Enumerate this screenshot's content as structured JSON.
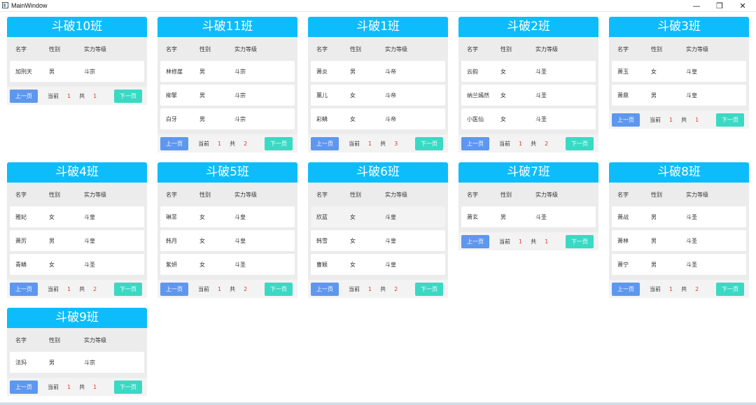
{
  "window": {
    "title": "MainWindow",
    "minimize_glyph": "—",
    "restore_glyph": "❐",
    "close_glyph": "✕"
  },
  "labels": {
    "col_name": "名字",
    "col_gender": "性别",
    "col_level": "实力等级",
    "prev": "上一页",
    "next": "下一页",
    "current": "当前",
    "total": "共"
  },
  "panels": [
    {
      "title": "斗破10班",
      "current": "1",
      "total": "1",
      "rows": [
        [
          "加刑天",
          "男",
          "斗宗"
        ]
      ]
    },
    {
      "title": "斗破11班",
      "current": "1",
      "total": "2",
      "rows": [
        [
          "林修崖",
          "男",
          "斗宗"
        ],
        [
          "柳擎",
          "男",
          "斗宗"
        ],
        [
          "白牙",
          "男",
          "斗宗"
        ]
      ]
    },
    {
      "title": "斗破1班",
      "current": "1",
      "total": "3",
      "rows": [
        [
          "萧炎",
          "男",
          "斗帝"
        ],
        [
          "薰儿",
          "女",
          "斗帝"
        ],
        [
          "彩鳞",
          "女",
          "斗帝"
        ]
      ]
    },
    {
      "title": "斗破2班",
      "current": "1",
      "total": "2",
      "rows": [
        [
          "云韵",
          "女",
          "斗圣"
        ],
        [
          "纳兰嫣然",
          "女",
          "斗圣"
        ],
        [
          "小医仙",
          "女",
          "斗圣"
        ]
      ]
    },
    {
      "title": "斗破3班",
      "current": "1",
      "total": "1",
      "rows": [
        [
          "萧玉",
          "女",
          "斗皇"
        ],
        [
          "萧鼎",
          "男",
          "斗皇"
        ]
      ]
    },
    {
      "title": "斗破4班",
      "current": "1",
      "total": "2",
      "rows": [
        [
          "雅妃",
          "女",
          "斗皇"
        ],
        [
          "萧厉",
          "男",
          "斗皇"
        ],
        [
          "青鳞",
          "女",
          "斗圣"
        ]
      ]
    },
    {
      "title": "斗破5班",
      "current": "1",
      "total": "2",
      "rows": [
        [
          "琳菲",
          "女",
          "斗皇"
        ],
        [
          "韩月",
          "女",
          "斗皇"
        ],
        [
          "紫妍",
          "女",
          "斗圣"
        ]
      ]
    },
    {
      "title": "斗破6班",
      "current": "1",
      "total": "2",
      "rows": [
        [
          "欣蓝",
          "女",
          "斗皇"
        ],
        [
          "韩雪",
          "女",
          "斗皇"
        ],
        [
          "曹颖",
          "女",
          "斗皇"
        ]
      ]
    },
    {
      "title": "斗破7班",
      "current": "1",
      "total": "1",
      "rows": [
        [
          "萧玄",
          "男",
          "斗圣"
        ]
      ]
    },
    {
      "title": "斗破8班",
      "current": "1",
      "total": "2",
      "rows": [
        [
          "萧战",
          "男",
          "斗圣"
        ],
        [
          "萧林",
          "男",
          "斗圣"
        ],
        [
          "萧宁",
          "男",
          "斗圣"
        ]
      ]
    },
    {
      "title": "斗破9班",
      "current": "1",
      "total": "1",
      "rows": [
        [
          "法犸",
          "男",
          "斗宗"
        ]
      ]
    }
  ]
}
